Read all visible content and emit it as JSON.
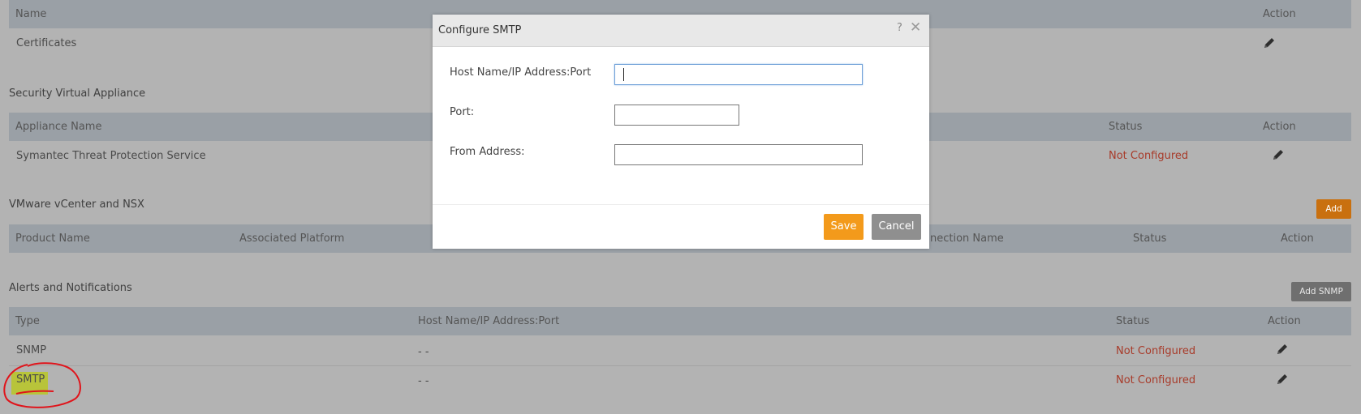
{
  "certificates": {
    "headers": {
      "name": "Name",
      "action": "Action"
    },
    "row": {
      "name": "Certificates"
    }
  },
  "sva": {
    "title": "Security Virtual Appliance",
    "headers": {
      "appliance_name": "Appliance Name",
      "status": "Status",
      "action": "Action"
    },
    "row": {
      "appliance_name": "Symantec Threat Protection Service",
      "status": "Not Configured"
    }
  },
  "vcenter": {
    "title": "VMware vCenter and NSX",
    "add_label": "Add",
    "headers": {
      "product_name": "Product Name",
      "associated_platform": "Associated Platform",
      "connection_name": "nection Name",
      "status": "Status",
      "action": "Action"
    }
  },
  "alerts": {
    "title": "Alerts and Notifications",
    "add_snmp_label": "Add SNMP",
    "headers": {
      "type": "Type",
      "host": "Host Name/IP Address:Port",
      "status": "Status",
      "action": "Action"
    },
    "rows": [
      {
        "type": "SNMP",
        "host": "- -",
        "status": "Not Configured"
      },
      {
        "type": "SMTP",
        "host": "- -",
        "status": "Not Configured"
      }
    ]
  },
  "modal": {
    "title": "Configure SMTP",
    "help": "?",
    "close": "✕",
    "fields": {
      "host_label": "Host Name/IP Address:Port",
      "port_label": "Port:",
      "from_label": "From Address:"
    },
    "save_label": "Save",
    "cancel_label": "Cancel"
  },
  "colors": {
    "overlay_bg": "#b3b3b3",
    "header_bg": "#9aa0a6",
    "not_configured": "#a83b2a",
    "save": "#f39a1b",
    "cancel": "#8f8f8f",
    "add": "#c9700f",
    "highlight": "#b8c43a",
    "annotation": "#e0141b"
  },
  "icons": {
    "edit": "pencil-icon"
  }
}
